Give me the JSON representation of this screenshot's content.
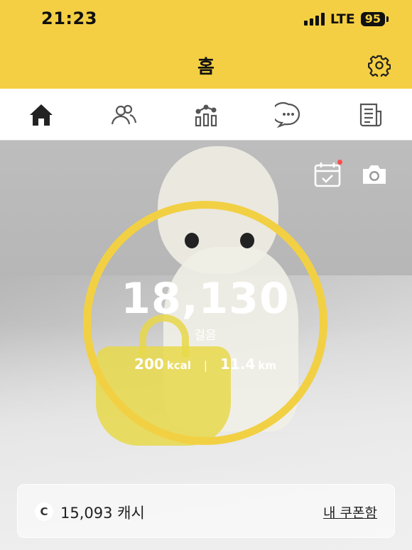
{
  "status_bar": {
    "time": "21:23",
    "network": "LTE",
    "battery": "95"
  },
  "header": {
    "title": "홈",
    "settings_icon": "gear-icon"
  },
  "tabs": [
    {
      "icon": "home-icon",
      "active": true
    },
    {
      "icon": "friends-icon",
      "active": false
    },
    {
      "icon": "stats-icon",
      "active": false
    },
    {
      "icon": "chat-icon",
      "active": false
    },
    {
      "icon": "news-icon",
      "active": false
    }
  ],
  "hero": {
    "steps": "18,130",
    "steps_label": "걸음",
    "kcal_value": "200",
    "kcal_unit": "kcal",
    "distance_value": "11.4",
    "distance_unit": "km",
    "separator": "|",
    "coin_symbol": "C",
    "cash_text": "15,093 캐시",
    "coupon_link": "내 쿠폰함",
    "calendar_icon": "calendar-check-icon",
    "camera_icon": "camera-icon"
  },
  "colors": {
    "brand_yellow": "#f5cf43",
    "ring_yellow": "#f2d043",
    "notification_dot": "#ff4b4b"
  }
}
